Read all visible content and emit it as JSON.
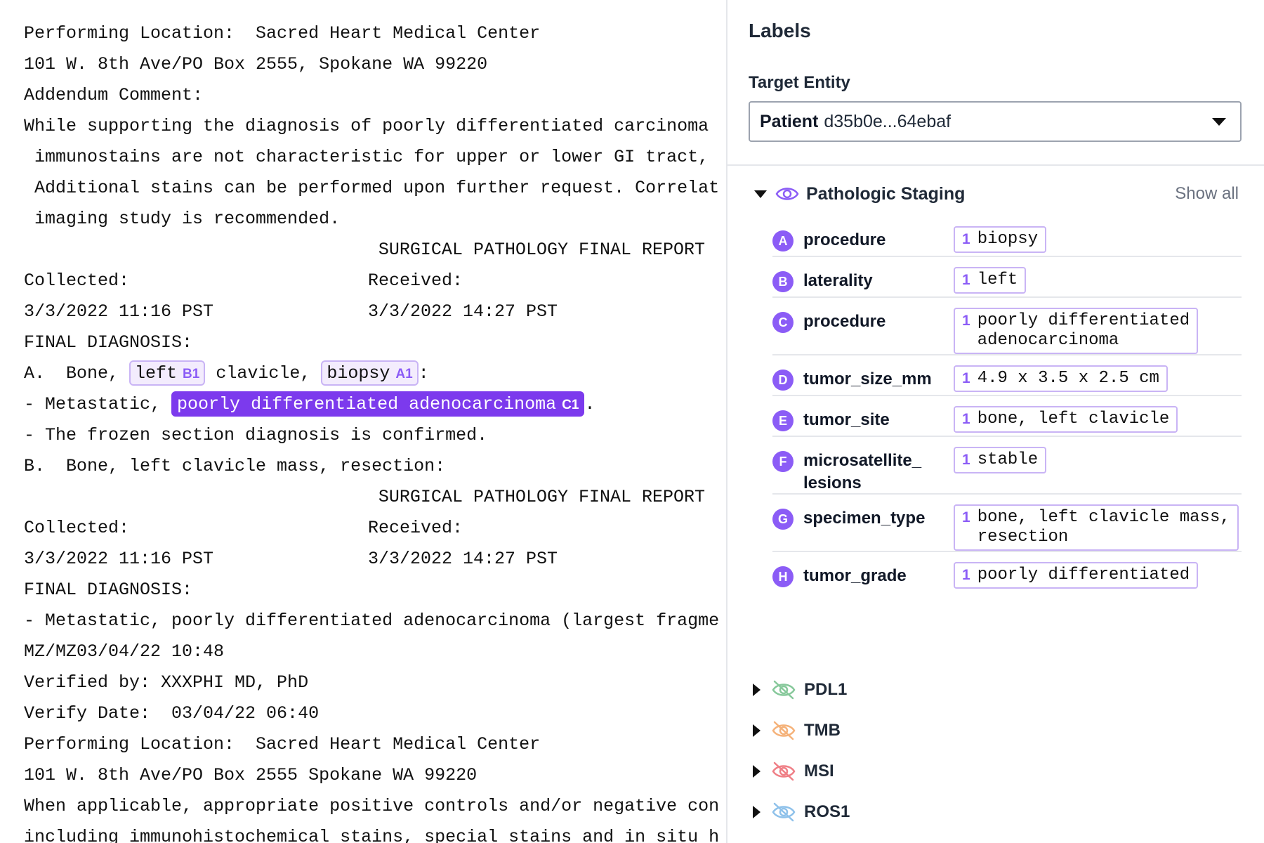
{
  "document": {
    "lines": [
      {
        "text": "Performing Location:  Sacred Heart Medical Center"
      },
      {
        "text": "101 W. 8th Ave/PO Box 2555, Spokane WA 99220"
      },
      {
        "text": "Addendum Comment:"
      },
      {
        "text": "While supporting the diagnosis of poorly differentiated carcinoma"
      },
      {
        "text": " immunostains are not characteristic for upper or lower GI tract,"
      },
      {
        "text": " Additional stains can be performed upon further request. Correlat"
      },
      {
        "text": " imaging study is recommended."
      },
      {
        "text": "SURGICAL PATHOLOGY FINAL REPORT",
        "align": "right"
      },
      {
        "text": "Collected:",
        "col2": "Received:"
      },
      {
        "text": "3/3/2022 11:16 PST",
        "col2": "3/3/2022 14:27 PST"
      },
      {
        "text": "FINAL DIAGNOSIS:"
      },
      {
        "segments": [
          {
            "text": "A.  Bone, "
          },
          {
            "text": "left",
            "tag": "B1",
            "style": "light"
          },
          {
            "text": " clavicle, "
          },
          {
            "text": "biopsy",
            "tag": "A1",
            "style": "light"
          },
          {
            "text": ":"
          }
        ]
      },
      {
        "segments": [
          {
            "text": "- Metastatic, "
          },
          {
            "text": "poorly differentiated adenocarcinoma",
            "tag": "C1",
            "style": "dark"
          },
          {
            "text": "."
          }
        ]
      },
      {
        "text": "- The frozen section diagnosis is confirmed."
      },
      {
        "text": "B.  Bone, left clavicle mass, resection:"
      },
      {
        "text": "SURGICAL PATHOLOGY FINAL REPORT",
        "align": "right"
      },
      {
        "text": "Collected:",
        "col2": "Received:"
      },
      {
        "text": "3/3/2022 11:16 PST",
        "col2": "3/3/2022 14:27 PST"
      },
      {
        "text": "FINAL DIAGNOSIS:"
      },
      {
        "text": "- Metastatic, poorly differentiated adenocarcinoma (largest fragme"
      },
      {
        "text": "MZ/MZ03/04/22 10:48"
      },
      {
        "text": "Verified by: XXXPHI MD, PhD"
      },
      {
        "text": "Verify Date:  03/04/22 06:40"
      },
      {
        "text": "Performing Location:  Sacred Heart Medical Center"
      },
      {
        "text": "101 W. 8th Ave/PO Box 2555 Spokane WA 99220"
      },
      {
        "text": "When applicable, appropriate positive controls and/or negative con"
      },
      {
        "text": "including immunohistochemical stains, special stains and in situ h"
      }
    ]
  },
  "panel": {
    "title": "Labels",
    "target_entity_label": "Target Entity",
    "entity_kind": "Patient",
    "entity_id": "d35b0e...64ebaf",
    "group": {
      "name": "Pathologic Staging",
      "show_all": "Show all",
      "rows": [
        {
          "badge": "A",
          "name": "procedure",
          "count": "1",
          "value": "biopsy"
        },
        {
          "badge": "B",
          "name": "laterality",
          "count": "1",
          "value": "left"
        },
        {
          "badge": "C",
          "name": "procedure",
          "count": "1",
          "value": "poorly differentiated\nadenocarcinoma"
        },
        {
          "badge": "D",
          "name": "tumor_size_mm",
          "count": "1",
          "value": "4.9 x 3.5 x 2.5 cm"
        },
        {
          "badge": "E",
          "name": "tumor_site",
          "count": "1",
          "value": "bone, left clavicle"
        },
        {
          "badge": "F",
          "name": "microsatellite_\nlesions",
          "count": "1",
          "value": "stable"
        },
        {
          "badge": "G",
          "name": "specimen_type",
          "count": "1",
          "value": "bone, left clavicle mass,\nresection"
        },
        {
          "badge": "H",
          "name": "tumor_grade",
          "count": "1",
          "value": "poorly differentiated"
        }
      ]
    },
    "collapsed_groups": [
      {
        "name": "PDL1",
        "color": "#86c89a"
      },
      {
        "name": "TMB",
        "color": "#f5b27a"
      },
      {
        "name": "MSI",
        "color": "#ef7f86"
      },
      {
        "name": "ROS1",
        "color": "#8ec1ea"
      }
    ],
    "accent_color": "#8b5cf6"
  }
}
